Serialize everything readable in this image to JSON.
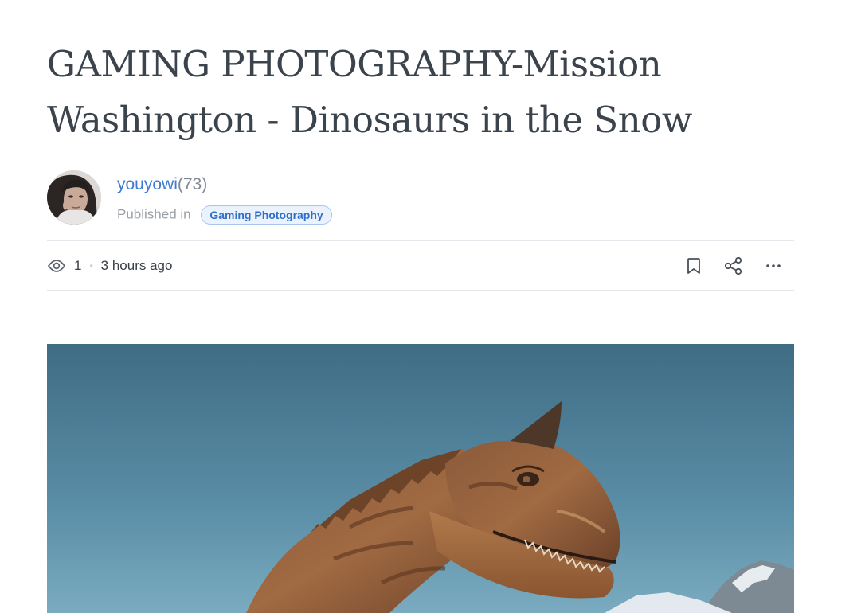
{
  "article": {
    "title": "GAMING PHOTOGRAPHY-Mission Washington - Dinosaurs in the Snow"
  },
  "author": {
    "name": "youyowi",
    "reputation": "(73)",
    "published_label": "Published in",
    "community": "Gaming Photography"
  },
  "meta": {
    "views": "1",
    "separator": "•",
    "time": "3 hours ago"
  },
  "icons": {
    "views": "eye-icon",
    "bookmark": "bookmark-icon",
    "share": "share-icon",
    "more": "more-icon"
  },
  "colors": {
    "link": "#3d7bd4",
    "tag_background": "#eaf2fd",
    "tag_border": "#a9c6f0",
    "title": "#3b434c"
  }
}
